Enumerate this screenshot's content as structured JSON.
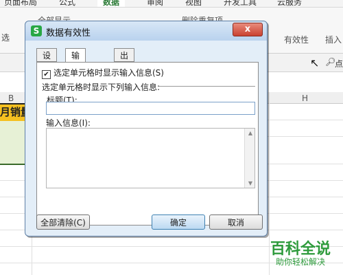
{
  "ribbon": {
    "tabs": [
      "页面布局",
      "公式",
      "数据",
      "审阅",
      "视图",
      "开发工具",
      "云服务"
    ],
    "active_tab": "数据",
    "left_label": "选",
    "show_all": "全部显示",
    "remove_dup": "删除重复项",
    "validation": "有效性",
    "insert": "插入"
  },
  "toolbar": {
    "find_label": "点"
  },
  "columns": [
    "B",
    "H"
  ],
  "cell": {
    "yellow_text": "月销量"
  },
  "dialog": {
    "title": "数据有效性",
    "app_icon": "S",
    "close": "x",
    "tabs": [
      "设置",
      "输入信息",
      "出错警告"
    ],
    "active_tab_index": 1,
    "checkbox_label": "选定单元格时显示输入信息(S)",
    "checkbox_checked": true,
    "group_label": "选定单元格时显示下列输入信息:",
    "title_field_label": "标题(T):",
    "title_value": "",
    "message_label": "输入信息(I):",
    "message_value": "",
    "clear_all": "全部清除(C)",
    "ok": "确定",
    "cancel": "取消"
  },
  "watermark": {
    "main": "百科全说",
    "sub": "助你轻松解决"
  },
  "colors": {
    "accent_green": "#2e9b3c",
    "cell_yellow": "#f5c020",
    "dialog_bg": "#e3eef8"
  }
}
